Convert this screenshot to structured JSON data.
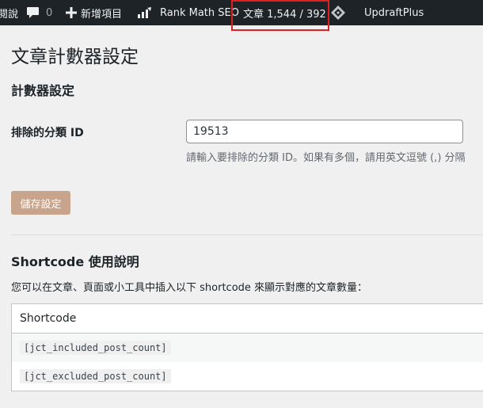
{
  "adminbar": {
    "partial_label": "閱說",
    "comments_count": "0",
    "new_item_label": "新增項目",
    "rank_math_label": "Rank Math SEO",
    "post_count_label": "文章 1,544 / 392",
    "updraft_label": "UpdraftPlus"
  },
  "page": {
    "title": "文章計數器設定",
    "section_title": "計數器設定",
    "exclude_label": "排除的分類 ID",
    "exclude_value": "19513",
    "exclude_desc": "請輸入要排除的分類 ID。如果有多個，請用英文逗號 (,) 分隔",
    "save_label": "儲存設定"
  },
  "shortcode": {
    "title": "Shortcode 使用說明",
    "intro": "您可以在文章、頁面或小工具中插入以下 shortcode 來顯示對應的文章數量：",
    "column_header": "Shortcode",
    "rows": [
      "[jct_included_post_count]",
      "[jct_excluded_post_count]"
    ]
  },
  "colors": {
    "adminbar_bg": "#1d2327",
    "highlight": "#e02020",
    "save_button": "#c9a48c"
  }
}
